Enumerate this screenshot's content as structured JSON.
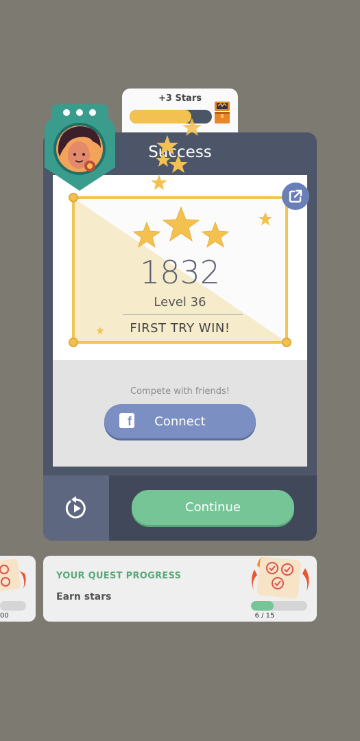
{
  "stars_reward": {
    "label": "+3 Stars",
    "progress": 0.75
  },
  "card": {
    "title": "Success"
  },
  "score_panel": {
    "score": "1832",
    "level": "Level 36",
    "achievement": "FIRST TRY WIN!",
    "stars_earned": 3
  },
  "social": {
    "prompt": "Compete with friends!",
    "connect_label": "Connect",
    "facebook_glyph": "f"
  },
  "actions": {
    "continue_label": "Continue",
    "replay_icon": "replay-icon",
    "share_icon": "share-icon"
  },
  "quest": {
    "heading": "YOUR QUEST PROGRESS",
    "task": "Earn stars",
    "current": 6,
    "total": 15,
    "count_label": "6 / 15",
    "progress": 0.4
  },
  "quest_prev": {
    "count_label": "00"
  },
  "colors": {
    "background": "#7d7a72",
    "card": "#4d5668",
    "accent_gold": "#f3c14f",
    "continue_green": "#76c597",
    "facebook_blue": "#7c8fc2"
  }
}
